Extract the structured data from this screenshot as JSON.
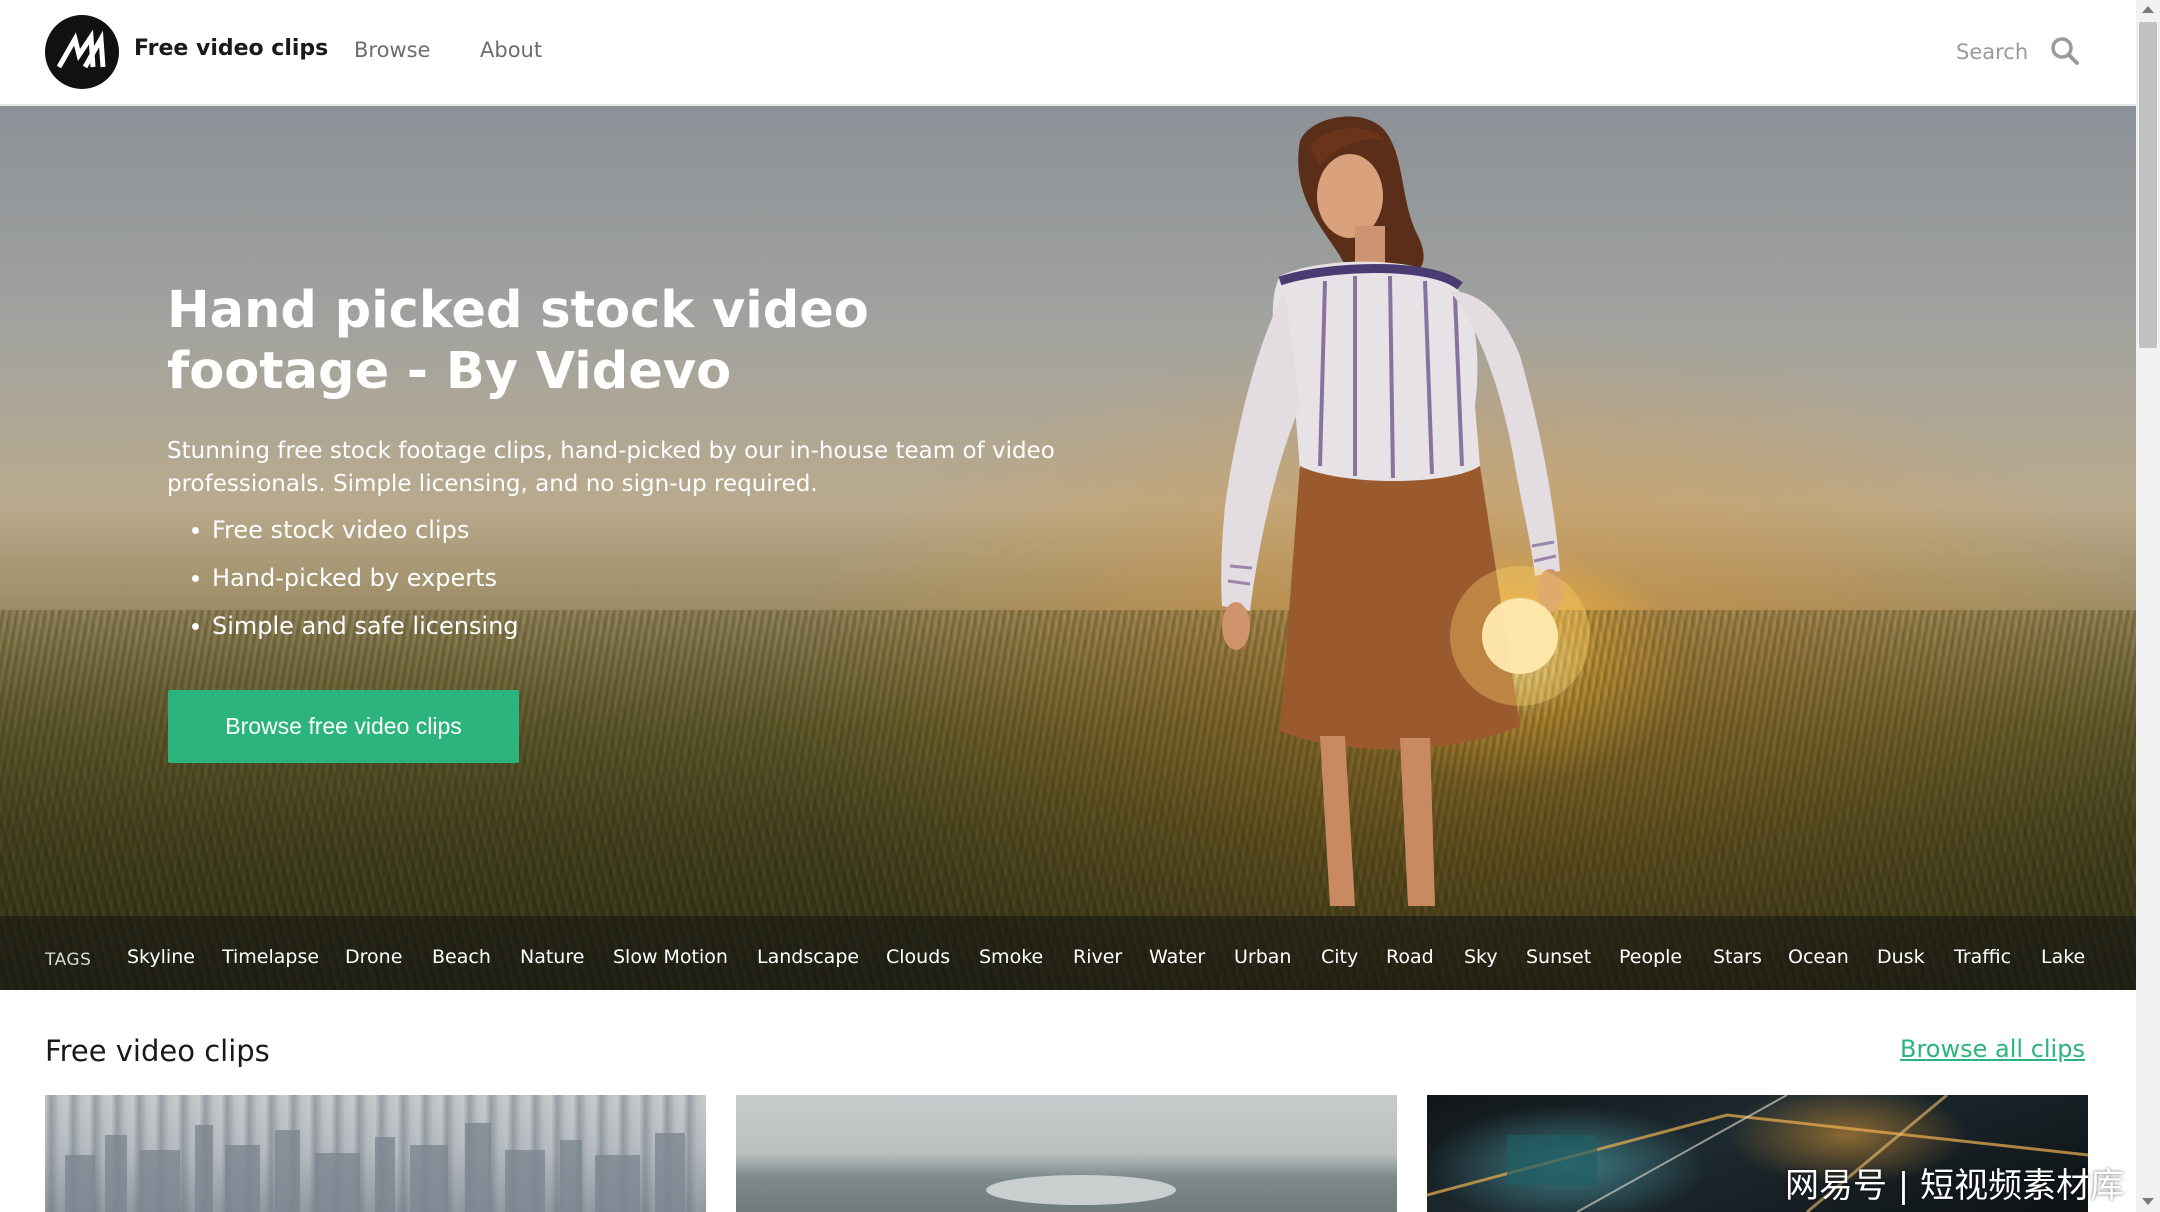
{
  "header": {
    "brand": "Free video clips",
    "nav": [
      "Browse",
      "About"
    ],
    "search_label": "Search"
  },
  "hero": {
    "title": "Hand picked stock video footage - By Videvo",
    "subtitle": "Stunning free stock footage clips, hand-picked by our in-house team of video professionals. Simple licensing, and no sign-up required.",
    "bullets": [
      "Free stock video clips",
      "Hand-picked by experts",
      "Simple and safe licensing"
    ],
    "cta_label": "Browse free video clips"
  },
  "tags": {
    "label": "TAGS",
    "items": [
      "Skyline",
      "Timelapse",
      "Drone",
      "Beach",
      "Nature",
      "Slow Motion",
      "Landscape",
      "Clouds",
      "Smoke",
      "River",
      "Water",
      "Urban",
      "City",
      "Road",
      "Sky",
      "Sunset",
      "People",
      "Stars",
      "Ocean",
      "Dusk",
      "Traffic",
      "Lake"
    ]
  },
  "clips": {
    "title": "Free video clips",
    "browse_all": "Browse all clips"
  },
  "watermark": "网易号 | 短视频素材库",
  "colors": {
    "accent": "#2bb57c",
    "logo": "#111111"
  },
  "icons": [
    "videvo-logo",
    "search-icon"
  ]
}
